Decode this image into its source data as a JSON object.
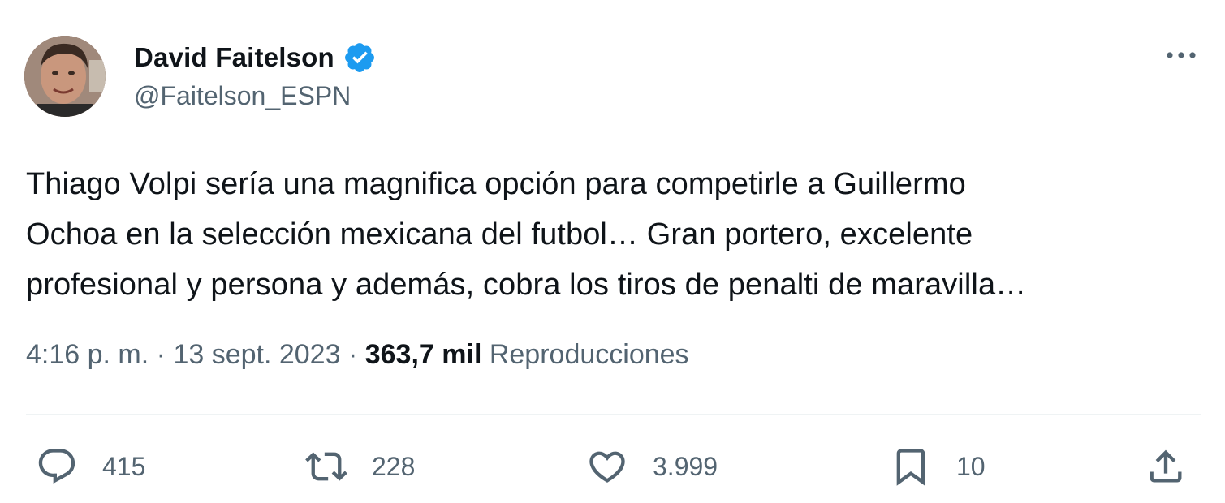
{
  "author": {
    "display_name": "David Faitelson",
    "handle": "@Faitelson_ESPN",
    "verified": true
  },
  "tweet": {
    "text": "Thiago Volpi sería una magnifica opción para competirle a Guillermo\nOchoa en la selección mexicana del futbol… Gran portero, excelente\nprofesional y persona y además, cobra los tiros de penalti de maravilla…",
    "time": "4:16 p. m.",
    "separator": "·",
    "date": "13 sept. 2023",
    "views_count": "363,7 mil",
    "views_label": "Reproducciones"
  },
  "actions": {
    "reply_count": "415",
    "retweet_count": "228",
    "like_count": "3.999",
    "bookmark_count": "10"
  },
  "icons": {
    "verified": "verified-badge-icon",
    "more": "more-dots-icon",
    "reply": "reply-bubble-icon",
    "retweet": "retweet-icon",
    "like": "heart-icon",
    "bookmark": "bookmark-icon",
    "share": "share-icon"
  },
  "colors": {
    "text_primary": "#0f1419",
    "text_secondary": "#536471",
    "verified_blue": "#1d9bf0",
    "divider": "#eff3f4"
  }
}
